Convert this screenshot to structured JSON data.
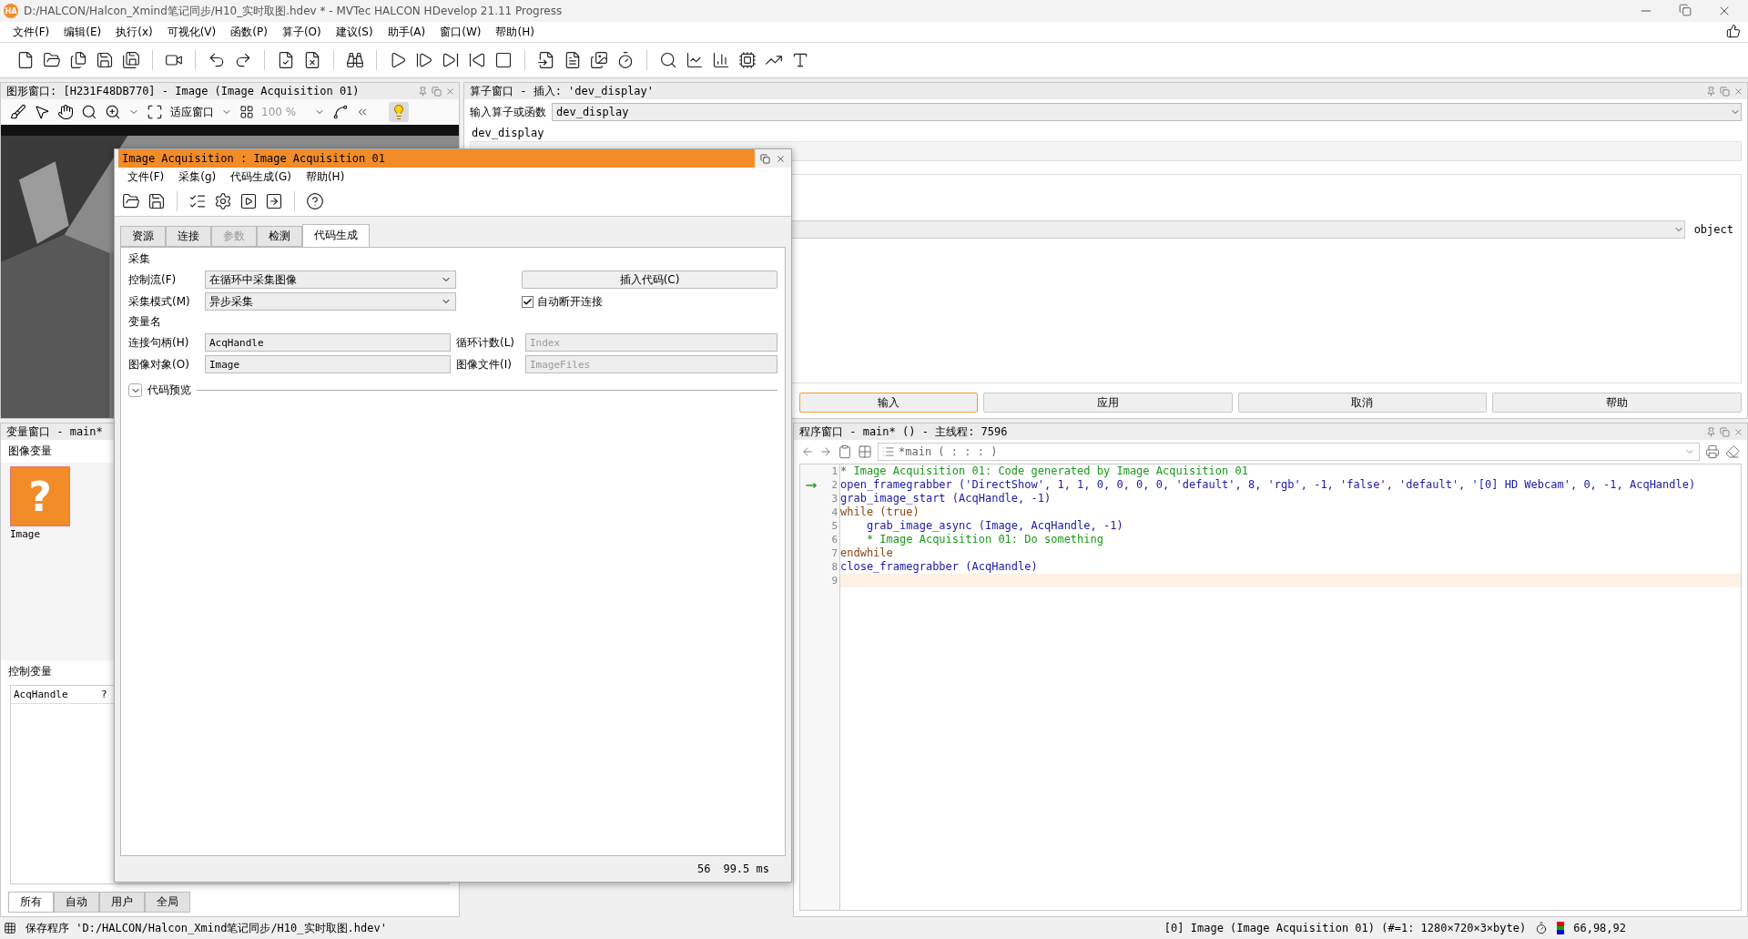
{
  "window": {
    "logo": "HA",
    "title": "D:/HALCON/Halcon_Xmind笔记同步/H10_实时取图.hdev * - MVTec HALCON HDevelop 21.11 Progress"
  },
  "menu": [
    "文件(F)",
    "编辑(E)",
    "执行(x)",
    "可视化(V)",
    "函数(P)",
    "算子(O)",
    "建议(S)",
    "助手(A)",
    "窗口(W)",
    "帮助(H)"
  ],
  "graphics_window": {
    "title": "图形窗口: [H231F48DB770] - Image (Image Acquisition 01)",
    "fit_label": "适应窗口",
    "zoom": "100 %"
  },
  "operator_window": {
    "title": "算子窗口 - 插入: 'dev_display'",
    "input_label": "输入算子或函数",
    "input_value": "dev_display",
    "operator_name": "dev_display",
    "param_type": "object",
    "buttons": [
      {
        "label": "输入",
        "selected": true
      },
      {
        "label": "应用",
        "selected": false
      },
      {
        "label": "取消",
        "selected": false
      },
      {
        "label": "帮助",
        "selected": false
      }
    ]
  },
  "variable_window": {
    "title": "变量窗口 - main*",
    "iconic_label": "图像变量",
    "iconic_vars": [
      {
        "name": "Image",
        "glyph": "?"
      }
    ],
    "control_label": "控制变量",
    "control_vars": [
      {
        "name": "AcqHandle",
        "value": "?"
      }
    ],
    "tabs": [
      {
        "label": "所有",
        "selected": true
      },
      {
        "label": "自动",
        "selected": false
      },
      {
        "label": "用户",
        "selected": false
      },
      {
        "label": "全局",
        "selected": false
      }
    ]
  },
  "program_window": {
    "title": "程序窗口 - main* () - 主线程: 7596",
    "procedure": "*main ( : : : )",
    "lines": [
      {
        "number": "1",
        "kind": "comment",
        "text": "* Image Acquisition 01: Code generated by Image Acquisition 01",
        "pc": false,
        "cursor": false
      },
      {
        "number": "2",
        "kind": "operator",
        "text": "open_framegrabber ('DirectShow', 1, 1, 0, 0, 0, 0, 'default', 8, 'rgb', -1, 'false', 'default', '[0] HD Webcam', 0, -1, AcqHandle)",
        "pc": true,
        "cursor": false
      },
      {
        "number": "3",
        "kind": "operator",
        "text": "grab_image_start (AcqHandle, -1)",
        "pc": false,
        "cursor": false
      },
      {
        "number": "4",
        "kind": "control",
        "text": "while (true)",
        "pc": false,
        "cursor": false
      },
      {
        "number": "5",
        "kind": "operator",
        "text": "    grab_image_async (Image, AcqHandle, -1)",
        "pc": false,
        "cursor": false
      },
      {
        "number": "6",
        "kind": "comment",
        "text": "    * Image Acquisition 01: Do something",
        "pc": false,
        "cursor": false
      },
      {
        "number": "7",
        "kind": "control",
        "text": "endwhile",
        "pc": false,
        "cursor": false
      },
      {
        "number": "8",
        "kind": "operator",
        "text": "close_framegrabber (AcqHandle)",
        "pc": false,
        "cursor": false
      },
      {
        "number": "9",
        "kind": "empty",
        "pc": false,
        "cursor": true
      }
    ]
  },
  "dialog": {
    "title": "Image Acquisition : Image Acquisition 01",
    "menu": [
      "文件(F)",
      "采集(g)",
      "代码生成(G)",
      "帮助(H)"
    ],
    "tabs": [
      {
        "label": "资源",
        "selected": false,
        "disabled": false
      },
      {
        "label": "连接",
        "selected": false,
        "disabled": false
      },
      {
        "label": "参数",
        "selected": false,
        "disabled": true
      },
      {
        "label": "检测",
        "selected": false,
        "disabled": false
      },
      {
        "label": "代码生成",
        "selected": true,
        "disabled": false
      }
    ],
    "acq_section": "采集",
    "control_flow": {
      "label": "控制流(F)",
      "value": "在循环中采集图像"
    },
    "acq_mode": {
      "label": "采集模式(M)",
      "value": "异步采集"
    },
    "insert_button": "插入代码(C)",
    "auto_disconnect": {
      "label": "自动断开连接",
      "checked": true
    },
    "vars_section": "变量名",
    "var_fields": [
      {
        "label": "连接句柄(H)",
        "value": "AcqHandle",
        "disabled": false
      },
      {
        "label": "循环计数(L)",
        "value": "Index",
        "disabled": true
      },
      {
        "label": "图像对象(O)",
        "value": "Image",
        "disabled": false
      },
      {
        "label": "图像文件(I)",
        "value": "ImageFiles",
        "disabled": true
      }
    ],
    "preview": {
      "label": "代码预览",
      "expanded": false
    },
    "frame_count": "56",
    "frame_time": "99.5 ms"
  },
  "status_bar": {
    "message": "保存程序 'D:/HALCON/Halcon_Xmind笔记同步/H10_实时取图.hdev'",
    "image_info": "[0] Image (Image Acquisition 01) (#=1: 1280×720×3×byte)",
    "pixel_value": "66,98,92"
  }
}
